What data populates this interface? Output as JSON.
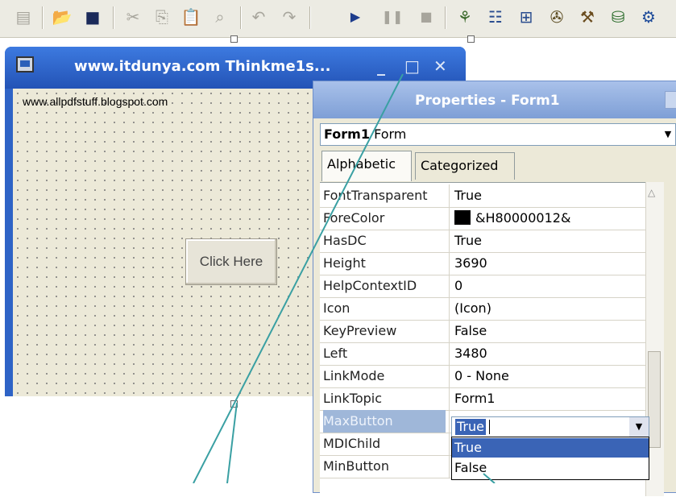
{
  "toolbar": {
    "icons": [
      "menu-editor-icon",
      "open-project-icon",
      "save-project-icon",
      "cut-icon",
      "copy-icon",
      "paste-icon",
      "find-icon",
      "undo-icon",
      "redo-icon",
      "start-icon",
      "break-icon",
      "end-icon",
      "project-explorer-icon",
      "properties-window-icon",
      "form-layout-icon",
      "object-browser-icon",
      "toolbox-icon",
      "data-view-icon",
      "component-manager-icon"
    ]
  },
  "form_window": {
    "title": "www.itdunya.com  Thinkme1s...",
    "label_text": "www.allpdfstuff.blogspot.com",
    "button_text": "Click Here",
    "minimize": "_",
    "maximize": "□",
    "close": "✕"
  },
  "properties_window": {
    "title": "Properties - Form1",
    "object_name": "Form1",
    "object_type": "Form",
    "tabs": [
      "Alphabetic",
      "Categorized"
    ],
    "rows": [
      {
        "name": "FontTransparent",
        "value": "True"
      },
      {
        "name": "ForeColor",
        "value": "&H80000012&"
      },
      {
        "name": "HasDC",
        "value": "True"
      },
      {
        "name": "Height",
        "value": "3690"
      },
      {
        "name": "HelpContextID",
        "value": "0"
      },
      {
        "name": "Icon",
        "value": "(Icon)"
      },
      {
        "name": "KeyPreview",
        "value": "False"
      },
      {
        "name": "Left",
        "value": "3480"
      },
      {
        "name": "LinkMode",
        "value": "0 - None"
      },
      {
        "name": "LinkTopic",
        "value": "Form1"
      },
      {
        "name": "MaxButton",
        "value": ""
      },
      {
        "name": "MDIChild",
        "value": ""
      },
      {
        "name": "MinButton",
        "value": ""
      }
    ],
    "selected_row": "MaxButton",
    "editor_value": "True",
    "dropdown_options": [
      "True",
      "False"
    ],
    "selected_option": "True"
  },
  "colors": {
    "titlebar_blue": "#2e63c6",
    "properties_title": "#8fabdf",
    "selection_blue": "#3a64b6",
    "form_background": "#ece9d8"
  }
}
